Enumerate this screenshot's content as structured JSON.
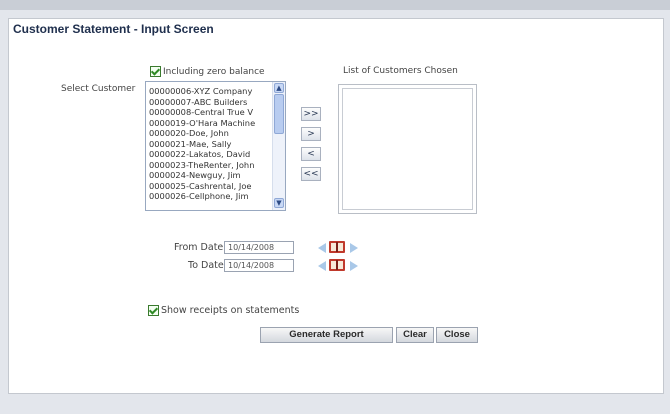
{
  "title": "Customer Statement -  Input Screen",
  "zero_balance_label": "Including zero balance",
  "select_customer_label": "Select Customer",
  "chosen_label": "List of Customers Chosen",
  "customers": [
    "00000006-XYZ Company",
    "00000007-ABC Builders",
    "00000008-Central True V",
    "0000019-O'Hara Machine",
    "0000020-Doe, John",
    "0000021-Mae, Sally",
    "0000022-Lakatos, David",
    "0000023-TheRenter, John",
    "0000024-Newguy, Jim",
    "0000025-Cashrental, Joe",
    "0000026-Cellphone, Jim"
  ],
  "move_buttons": {
    "all_right": ">>",
    "right": ">",
    "left": "<",
    "all_left": "<<"
  },
  "from_date_label": "From Date :",
  "from_date_value": "10/14/2008",
  "to_date_label": "To Date :",
  "to_date_value": "10/14/2008",
  "show_receipts_label": "Show receipts on statements",
  "buttons": {
    "generate": "Generate Report",
    "clear": "Clear",
    "close": "Close"
  },
  "icons": {
    "calendar": "calendar-icon",
    "checkbox": "checkbox-checked-icon"
  },
  "colors": {
    "title": "#1f2f4d",
    "check": "#2f8a25",
    "panel_bg": "#ffffff",
    "page_bg": "#e3e6ec"
  }
}
